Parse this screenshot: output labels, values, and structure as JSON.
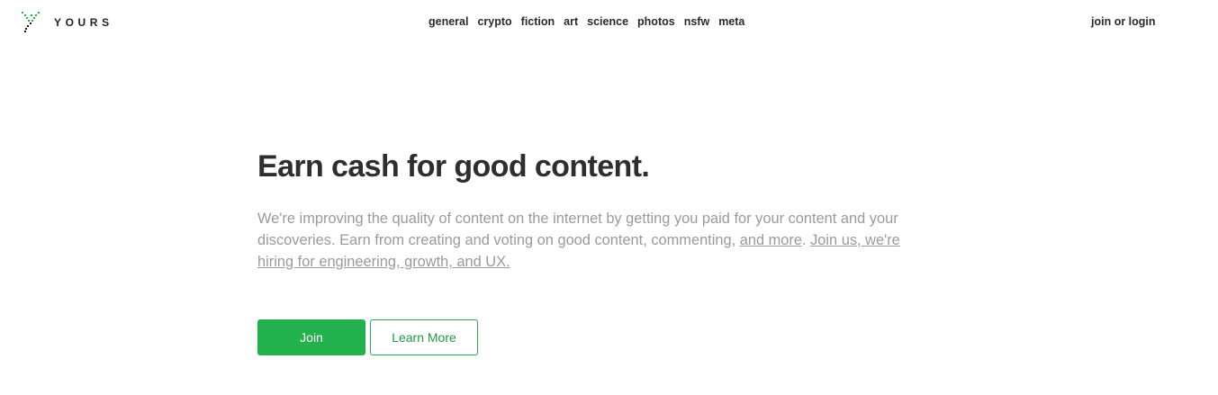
{
  "brand": {
    "name": "YOURS",
    "accent_color": "#22b14c",
    "logo_icon": "dotted-v-logo-icon"
  },
  "nav": {
    "items": [
      "general",
      "crypto",
      "fiction",
      "art",
      "science",
      "photos",
      "nsfw",
      "meta"
    ]
  },
  "auth": {
    "login_label": "join or login"
  },
  "hero": {
    "title": "Earn cash for good content.",
    "description_text": "We're improving the quality of content on the internet by getting you paid for your content and your discoveries. Earn from creating and voting on good content, commenting, ",
    "description_link_more": "and more",
    "description_separator": ". ",
    "description_link_hiring": "Join us, we're hiring for engineering, growth, and UX."
  },
  "actions": {
    "join_label": "Join",
    "learn_more_label": "Learn More"
  }
}
